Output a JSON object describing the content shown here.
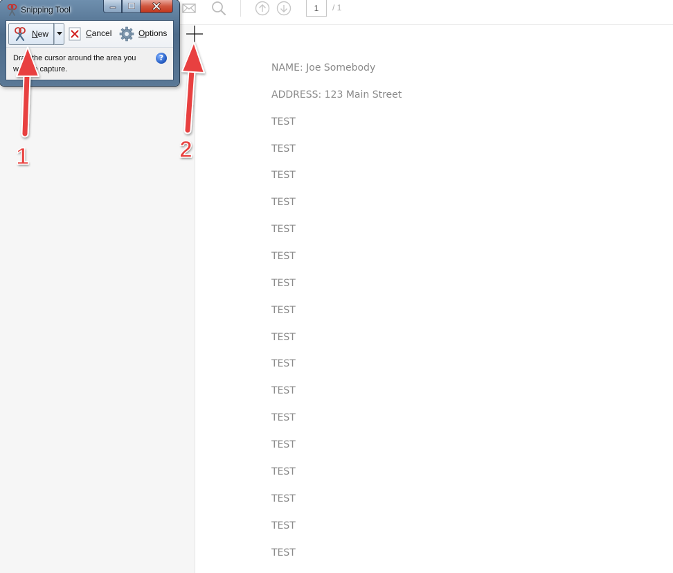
{
  "viewer": {
    "page_current": "1",
    "page_total": "/ 1",
    "toolbar_icons": [
      "mail-icon",
      "search-icon",
      "page-up-icon",
      "page-down-icon"
    ]
  },
  "document": {
    "lines": [
      "NAME: Joe Somebody",
      "ADDRESS: 123 Main Street",
      "TEST",
      "TEST",
      "TEST",
      "TEST",
      "TEST",
      "TEST",
      "TEST",
      "TEST",
      "TEST",
      "TEST",
      "TEST",
      "TEST",
      "TEST",
      "TEST",
      "TEST",
      "TEST",
      "TEST"
    ]
  },
  "snipping_tool": {
    "title": "Snipping Tool",
    "new_label": "New",
    "cancel_label": "Cancel",
    "options_label": "Options",
    "message": "Drag the cursor around the area you want to capture.",
    "help_glyph": "?"
  },
  "annotations": {
    "label_1": "1",
    "label_2": "2",
    "color": "#e8413f"
  }
}
